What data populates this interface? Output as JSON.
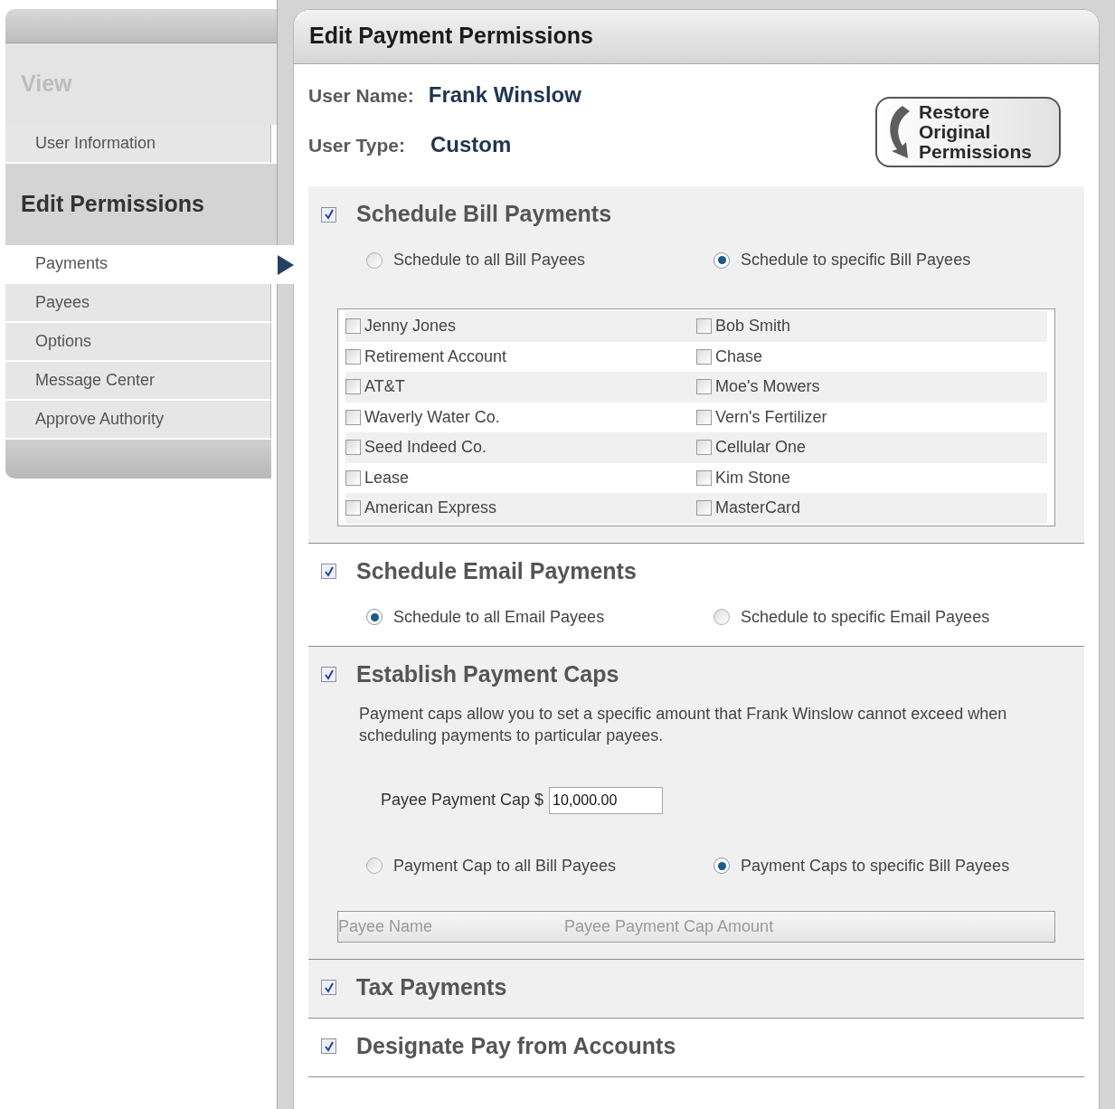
{
  "sidebar": {
    "groups": [
      {
        "title": "View",
        "active": false,
        "items": [
          {
            "label": "User Information",
            "selected": false
          }
        ]
      },
      {
        "title": "Edit Permissions",
        "active": true,
        "items": [
          {
            "label": "Payments",
            "selected": true
          },
          {
            "label": "Payees",
            "selected": false
          },
          {
            "label": "Options",
            "selected": false
          },
          {
            "label": "Message Center",
            "selected": false
          },
          {
            "label": "Approve Authority",
            "selected": false
          }
        ]
      }
    ]
  },
  "panel": {
    "title": "Edit Payment Permissions",
    "user_name_label": "User Name:",
    "user_name": "Frank Winslow",
    "user_type_label": "User Type:",
    "user_type": "Custom",
    "restore_button": "Restore Original Permissions",
    "sections": [
      {
        "title": "Schedule Bill Payments",
        "checked": true,
        "shaded": true,
        "options": [
          {
            "label": "Schedule to all Bill Payees",
            "selected": false
          },
          {
            "label": "Schedule to specific Bill Payees",
            "selected": true
          }
        ],
        "payees": [
          {
            "label": "Jenny Jones",
            "checked": false
          },
          {
            "label": "Bob Smith",
            "checked": false
          },
          {
            "label": "Retirement Account",
            "checked": false
          },
          {
            "label": "Chase",
            "checked": false
          },
          {
            "label": "AT&T",
            "checked": false
          },
          {
            "label": "Moe's Mowers",
            "checked": false
          },
          {
            "label": "Waverly Water Co.",
            "checked": false
          },
          {
            "label": "Vern's Fertilizer",
            "checked": false
          },
          {
            "label": "Seed Indeed Co.",
            "checked": false
          },
          {
            "label": "Cellular One",
            "checked": false
          },
          {
            "label": "Lease",
            "checked": false
          },
          {
            "label": "Kim Stone",
            "checked": false
          },
          {
            "label": "American Express",
            "checked": false
          },
          {
            "label": "MasterCard",
            "checked": false
          }
        ]
      },
      {
        "title": "Schedule Email Payments",
        "checked": true,
        "shaded": false,
        "options": [
          {
            "label": "Schedule to all Email Payees",
            "selected": true
          },
          {
            "label": "Schedule to specific Email Payees",
            "selected": false
          }
        ]
      },
      {
        "title": "Establish Payment Caps",
        "checked": true,
        "shaded": true,
        "description": "Payment caps allow you to set a specific amount that Frank Winslow cannot exceed when scheduling payments to particular payees.",
        "cap_label": "Payee Payment Cap $",
        "cap_value": "10,000.00",
        "options": [
          {
            "label": "Payment Cap to all Bill Payees",
            "selected": false
          },
          {
            "label": "Payment Caps to specific Bill Payees",
            "selected": true
          }
        ],
        "cap_columns": [
          "Payee Name",
          "Payee Payment Cap Amount"
        ]
      },
      {
        "title": "Tax Payments",
        "checked": true,
        "shaded": true
      },
      {
        "title": "Designate Pay from Accounts",
        "checked": true,
        "shaded": false
      }
    ]
  }
}
